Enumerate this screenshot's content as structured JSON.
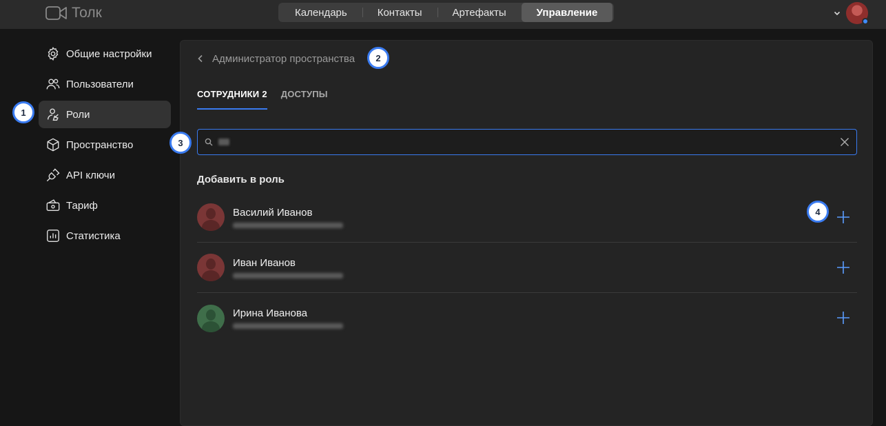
{
  "app": {
    "name": "Толк",
    "colors": {
      "accent": "#3a7bf0",
      "background": "#161616",
      "panel": "#242424",
      "topbar": "#2b2b2b"
    }
  },
  "nav": {
    "tabs": [
      {
        "label": "Календарь",
        "active": false
      },
      {
        "label": "Контакты",
        "active": false
      },
      {
        "label": "Артефакты",
        "active": false
      },
      {
        "label": "Управление",
        "active": true
      }
    ]
  },
  "profile": {
    "icon": "chevron-down-icon",
    "status": "online"
  },
  "sidebar": {
    "items": [
      {
        "label": "Общие настройки",
        "icon": "gear-icon",
        "active": false
      },
      {
        "label": "Пользователи",
        "icon": "users-icon",
        "active": false
      },
      {
        "label": "Роли",
        "icon": "roles-icon",
        "active": true
      },
      {
        "label": "Пространство",
        "icon": "cube-icon",
        "active": false
      },
      {
        "label": "API ключи",
        "icon": "plug-icon",
        "active": false
      },
      {
        "label": "Тариф",
        "icon": "wallet-icon",
        "active": false
      },
      {
        "label": "Статистика",
        "icon": "chart-icon",
        "active": false
      }
    ]
  },
  "main": {
    "breadcrumb": "Администратор пространства",
    "tabs": [
      {
        "label": "СОТРУДНИКИ",
        "count": "2",
        "active": true
      },
      {
        "label": "ДОСТУПЫ",
        "count": "",
        "active": false
      }
    ],
    "search": {
      "value": "",
      "placeholder": ""
    },
    "section_title": "Добавить в роль",
    "users": [
      {
        "name": "Василий Иванов",
        "avatar_color": "#7a3636"
      },
      {
        "name": "Иван Иванов",
        "avatar_color": "#7a3636"
      },
      {
        "name": "Ирина Иванова",
        "avatar_color": "#3f6e4a"
      }
    ]
  },
  "badges": [
    "1",
    "2",
    "3",
    "4"
  ]
}
